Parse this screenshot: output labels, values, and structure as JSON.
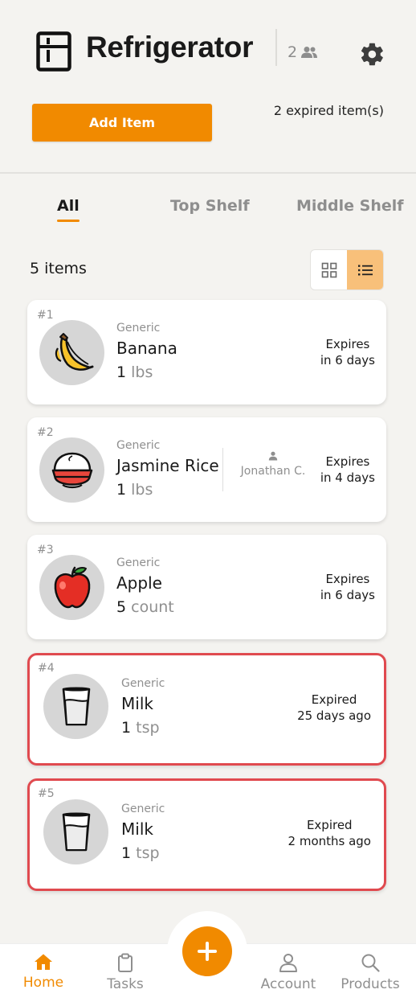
{
  "header": {
    "title": "Refrigerator",
    "member_count": "2",
    "add_item_label": "Add Item",
    "expired_summary": "2 expired item(s)"
  },
  "tabs": [
    {
      "label": "All",
      "active": true
    },
    {
      "label": "Top Shelf",
      "active": false
    },
    {
      "label": "Middle Shelf",
      "active": false
    }
  ],
  "list": {
    "count_label": "5 items",
    "view_mode": "list"
  },
  "items": [
    {
      "num": "#1",
      "brand": "Generic",
      "name": "Banana",
      "qty": "1",
      "unit": "lbs",
      "status_line1": "Expires",
      "status_line2": "in 6 days",
      "icon": "banana-icon",
      "expired": false
    },
    {
      "num": "#2",
      "brand": "Generic",
      "name": "Jasmine Rice",
      "qty": "1",
      "unit": "lbs",
      "owner": "Jonathan C.",
      "status_line1": "Expires",
      "status_line2": "in 4 days",
      "icon": "rice-bowl-icon",
      "expired": false
    },
    {
      "num": "#3",
      "brand": "Generic",
      "name": "Apple",
      "qty": "5",
      "unit": "count",
      "status_line1": "Expires",
      "status_line2": "in 6 days",
      "icon": "apple-icon",
      "expired": false
    },
    {
      "num": "#4",
      "brand": "Generic",
      "name": "Milk",
      "qty": "1",
      "unit": "tsp",
      "status_line1": "Expired",
      "status_line2": "25 days ago",
      "icon": "milk-glass-icon",
      "expired": true
    },
    {
      "num": "#5",
      "brand": "Generic",
      "name": "Milk",
      "qty": "1",
      "unit": "tsp",
      "status_line1": "Expired",
      "status_line2": "2 months ago",
      "icon": "milk-glass-icon",
      "expired": true
    }
  ],
  "nav": {
    "home": "Home",
    "tasks": "Tasks",
    "account": "Account",
    "products": "Products"
  },
  "colors": {
    "accent": "#f18a00",
    "expired_border": "#e04a4f",
    "background": "#f4f3f0"
  }
}
